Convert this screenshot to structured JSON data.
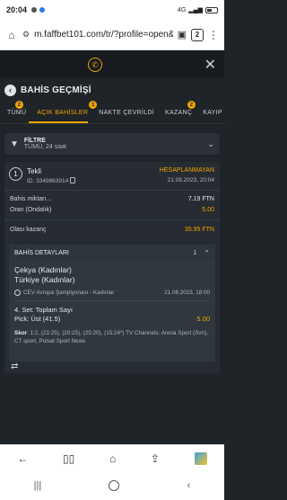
{
  "status_bar": {
    "time": "20:04",
    "network": "4G"
  },
  "browser": {
    "url": "m.faffbet101.com/tr/?profile=open&accour",
    "tab_count": "2"
  },
  "page": {
    "title": "BAHİS GEÇMİŞİ"
  },
  "tabs": [
    {
      "label": "TÜMÜ",
      "badge": "2",
      "active": false
    },
    {
      "label": "AÇIK BAHİSLER",
      "badge": "1",
      "active": true
    },
    {
      "label": "NAKTE ÇEVRİLDİ",
      "badge": "",
      "active": false
    },
    {
      "label": "KAZANÇ",
      "badge": "2",
      "active": false
    },
    {
      "label": "KAYIP",
      "badge": "",
      "active": false
    }
  ],
  "filter": {
    "title": "FİLTRE",
    "subtitle": "TÜMÜ, 24 saat"
  },
  "bet": {
    "index": "1",
    "type": "Tekli",
    "id": "ID: 3349863914",
    "status": "HESAPLANMAYAN",
    "date": "21.08.2023, 20:04",
    "amount_label": "Bahis miktarı...",
    "amount_value": "7.19 FTN",
    "odds_label": "Oran (Ondalık)",
    "odds_value": "5.00",
    "potential_label": "Olası kazanç",
    "potential_value": "35.95 FTN",
    "details_label": "BAHİS DETAYLARI",
    "details_count": "1",
    "event": {
      "team1": "Çekya (Kadınlar)",
      "team2": "Türkiye (Kadınlar)",
      "league": "CEV Avrupa Şampiyonası - Kadınlar",
      "datetime": "21.08.2023, 18:00",
      "market": "4. Set: Toplam Sayı",
      "pick": "Pick: Üst (41.5)",
      "pick_odds": "5.00",
      "score_label": "Skor",
      "score_text": ": 1:2, (23:25), (20:25), (25:20), (15:24*) TV Channels: Arena Sport (Svn), CT sport, Polsat Sport News"
    }
  }
}
